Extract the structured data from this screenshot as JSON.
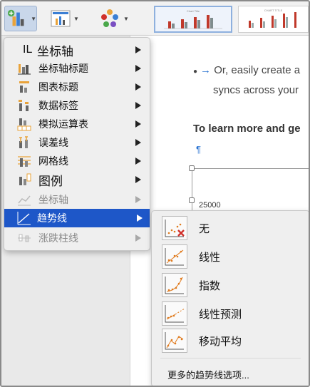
{
  "colors": {
    "accent": "#1e57c8",
    "menu_bg": "#efefef",
    "link": "#2b74d2",
    "trend_dot": "#e07b1e",
    "cross": "#d0302a"
  },
  "ribbon": {
    "add_chart_element_icon": "chart-add-icon",
    "quick_layout_icon": "quick-layout-icon",
    "change_colors_icon": "color-palette-icon",
    "style_thumb_title": "Chart Title",
    "style_thumb2_title": "CHART TITLE"
  },
  "document": {
    "line1": "Or, easily create a",
    "line2": "syncs across your",
    "line3": "To learn more and ge",
    "pilcrow": "¶",
    "axis_value": "25000"
  },
  "menu": {
    "items": [
      {
        "label": "坐标轴",
        "prefix": "IL",
        "icon": "axes-icon"
      },
      {
        "label": "坐标轴标题",
        "icon": "axis-titles-icon"
      },
      {
        "label": "图表标题",
        "icon": "chart-title-icon"
      },
      {
        "label": "数据标签",
        "icon": "data-labels-icon"
      },
      {
        "label": "模拟运算表",
        "icon": "data-table-icon"
      },
      {
        "label": "误差线",
        "icon": "error-bars-icon"
      },
      {
        "label": "网格线",
        "icon": "gridlines-icon"
      },
      {
        "label": "图例",
        "icon": "legend-icon"
      },
      {
        "label": "坐标轴",
        "icon": "lines-icon"
      },
      {
        "label": "趋势线",
        "icon": "trendline-icon"
      },
      {
        "label": "涨跌柱线",
        "icon": "up-down-bars-icon"
      }
    ]
  },
  "submenu": {
    "items": [
      {
        "label": "无",
        "icon": "trendline-none-icon"
      },
      {
        "label": "线性",
        "icon": "trendline-linear-icon"
      },
      {
        "label": "指数",
        "icon": "trendline-exponential-icon"
      },
      {
        "label": "线性预测",
        "icon": "trendline-linear-forecast-icon"
      },
      {
        "label": "移动平均",
        "icon": "trendline-moving-average-icon"
      }
    ],
    "more_label": "更多的趋势线选项..."
  }
}
